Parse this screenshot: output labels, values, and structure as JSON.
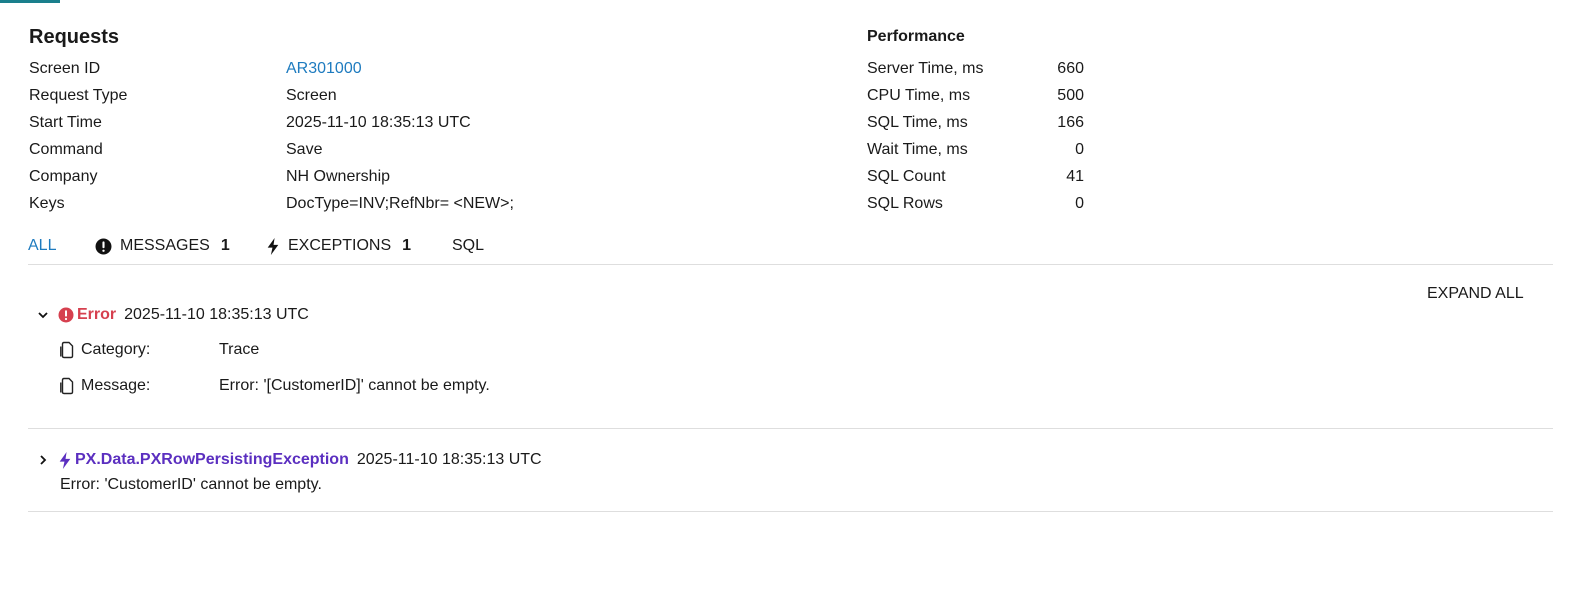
{
  "requests": {
    "title": "Requests",
    "screen_id": {
      "label": "Screen ID",
      "value": "AR301000"
    },
    "request_type": {
      "label": "Request Type",
      "value": "Screen"
    },
    "start_time": {
      "label": "Start Time",
      "value": "2025-11-10 18:35:13 UTC"
    },
    "command": {
      "label": "Command",
      "value": "Save"
    },
    "company": {
      "label": "Company",
      "value": "NH Ownership"
    },
    "keys": {
      "label": "Keys",
      "value": "DocType=INV;RefNbr= <NEW>;"
    }
  },
  "performance": {
    "title": "Performance",
    "server_time": {
      "label": "Server Time, ms",
      "value": "660"
    },
    "cpu_time": {
      "label": "CPU Time, ms",
      "value": "500"
    },
    "sql_time": {
      "label": "SQL Time, ms",
      "value": "166"
    },
    "wait_time": {
      "label": "Wait Time, ms",
      "value": "0"
    },
    "sql_count": {
      "label": "SQL Count",
      "value": "41"
    },
    "sql_rows": {
      "label": "SQL Rows",
      "value": "0"
    }
  },
  "tabs": {
    "all": {
      "label": "ALL",
      "active": true
    },
    "messages": {
      "label": "MESSAGES",
      "count": "1",
      "icon": "exclamation-circle-icon"
    },
    "exceptions": {
      "label": "EXCEPTIONS",
      "count": "1",
      "icon": "lightning-icon"
    },
    "sql": {
      "label": "SQL"
    }
  },
  "expand_all_label": "EXPAND ALL",
  "entries": {
    "error": {
      "expanded": true,
      "level": "Error",
      "time": "2025-11-10 18:35:13 UTC",
      "category": {
        "label": "Category:",
        "value": "Trace"
      },
      "message": {
        "label": "Message:",
        "value": "Error: '[CustomerID]' cannot be empty."
      }
    },
    "exception": {
      "expanded": false,
      "type": "PX.Data.PXRowPersistingException",
      "time": "2025-11-10 18:35:13 UTC",
      "message": "Error: 'CustomerID' cannot be empty."
    }
  },
  "colors": {
    "link": "#1e7bbf",
    "error": "#d6404f",
    "exception": "#5b2fc0",
    "accent": "#1a7f8c",
    "divider": "#dedede"
  }
}
